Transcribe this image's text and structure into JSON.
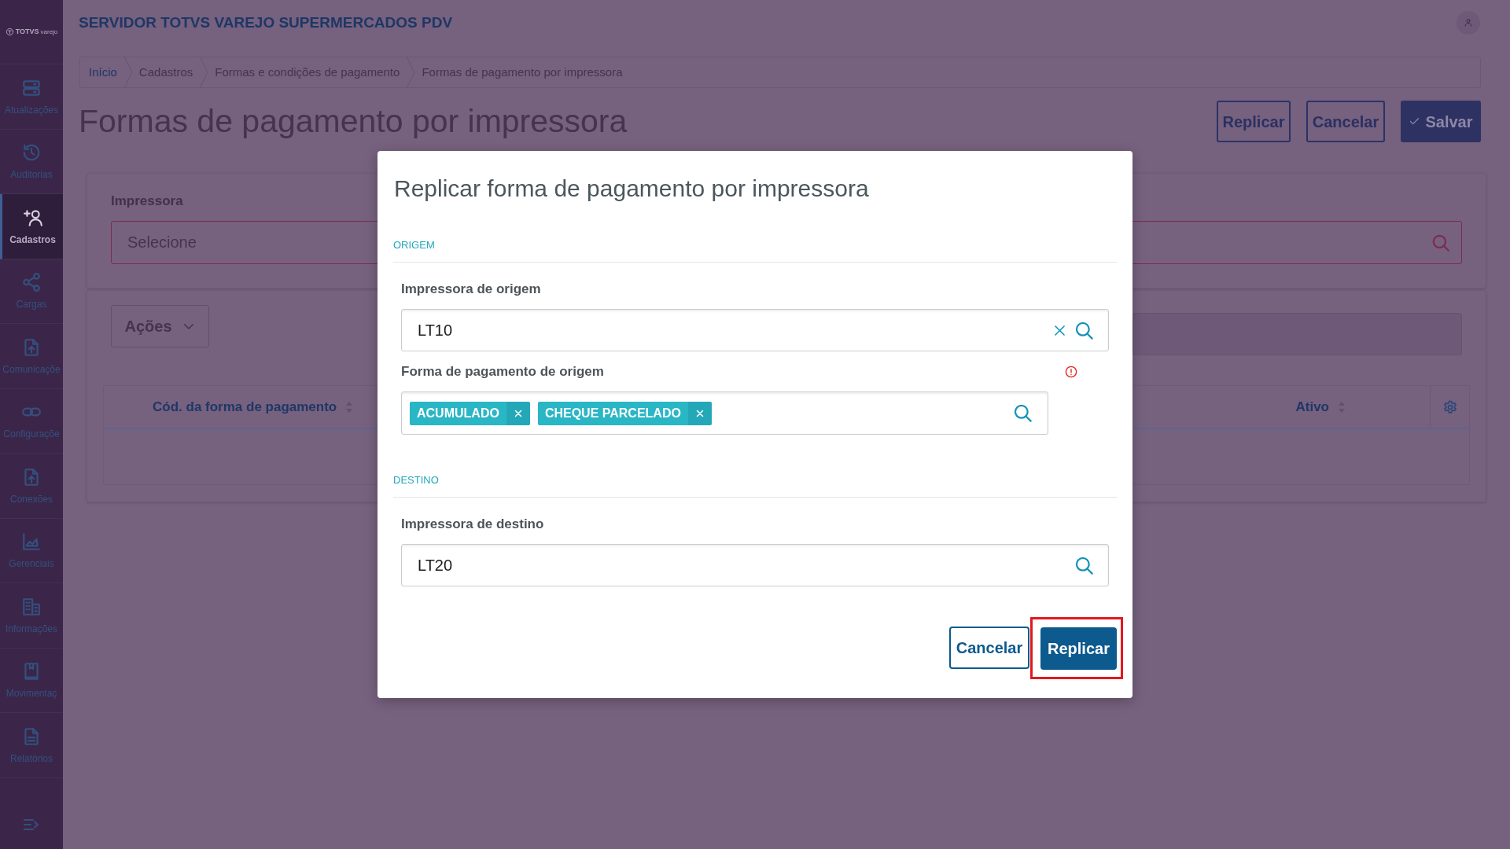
{
  "sidebar": {
    "logo": {
      "text": "TOTVS",
      "tagline": "varejo"
    },
    "items": [
      {
        "label": "Atualizações",
        "selected": false
      },
      {
        "label": "Auditorias",
        "selected": false
      },
      {
        "label": "Cadastros",
        "selected": true
      },
      {
        "label": "Cargas",
        "selected": false
      },
      {
        "label": "Comunicaçõe",
        "selected": false
      },
      {
        "label": "Configuraçõe",
        "selected": false
      },
      {
        "label": "Conexões",
        "selected": false
      },
      {
        "label": "Gerenciais",
        "selected": false
      },
      {
        "label": "Informações",
        "selected": false
      },
      {
        "label": "Movimentaç",
        "selected": false
      },
      {
        "label": "Relatórios",
        "selected": false
      }
    ]
  },
  "header": {
    "title": "SERVIDOR TOTVS VAREJO SUPERMERCADOS PDV"
  },
  "breadcrumb": [
    {
      "label": "Início",
      "kind": "link"
    },
    {
      "label": "Cadastros",
      "kind": "plain"
    },
    {
      "label": "Formas e condições de pagamento",
      "kind": "plain"
    },
    {
      "label": "Formas de pagamento por impressora",
      "kind": "plain"
    }
  ],
  "page": {
    "title": "Formas de pagamento por impressora",
    "actions": [
      {
        "label": "Replicar",
        "kind": "outline"
      },
      {
        "label": "Cancelar",
        "kind": "outline"
      },
      {
        "label": "Salvar",
        "kind": "save"
      }
    ]
  },
  "filter": {
    "label": "Impressora",
    "placeholder": "Selecione",
    "error": true
  },
  "toolbar": {
    "actions_menu": "Ações"
  },
  "table": {
    "columns": [
      "Cód. da forma de pagamento",
      "Ativo"
    ]
  },
  "modal": {
    "title": "Replicar forma de pagamento por impressora",
    "sections": [
      {
        "heading": "ORIGEM",
        "fields": [
          {
            "label": "Impressora de origem",
            "kind": "lookup",
            "value": "LT10",
            "clearable": true,
            "error": false
          },
          {
            "label": "Forma de pagamento de origem",
            "kind": "multiselect",
            "tags": [
              "ACUMULADO",
              "CHEQUE PARCELADO"
            ],
            "error": true
          }
        ]
      },
      {
        "heading": "DESTINO",
        "fields": [
          {
            "label": "Impressora de destino",
            "kind": "lookup",
            "value": "LT20",
            "clearable": false,
            "error": false
          }
        ]
      }
    ],
    "buttons": [
      {
        "label": "Cancelar",
        "kind": "outline",
        "highlighted": false
      },
      {
        "label": "Replicar",
        "kind": "primary",
        "highlighted": true
      }
    ]
  }
}
